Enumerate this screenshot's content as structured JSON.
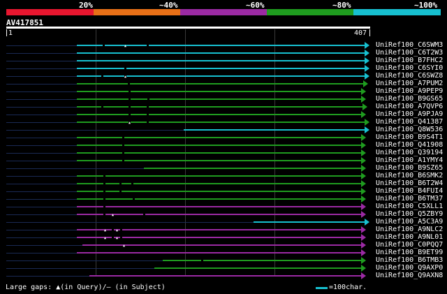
{
  "header": {
    "identity_ticks": [
      "20%",
      "~40%",
      "~60%",
      "~80%",
      "~100%"
    ],
    "identity_colors": [
      "#e8162f",
      "#e87017",
      "#9b2aa3",
      "#1f9c1f",
      "#17c0d0"
    ],
    "query_id": "AV417851",
    "query_start": "1",
    "query_end": "407"
  },
  "hits": [
    {
      "name": "UniRef100_C6SWM3",
      "color": "cyan"
    },
    {
      "name": "UniRef100_C6T2W3",
      "color": "cyan"
    },
    {
      "name": "UniRef100_B7FHC2",
      "color": "cyan"
    },
    {
      "name": "UniRef100_C6SYI0",
      "color": "cyan"
    },
    {
      "name": "UniRef100_C6SWZ8",
      "color": "cyan"
    },
    {
      "name": "UniRef100_A7PUM2",
      "color": "green"
    },
    {
      "name": "UniRef100_A9PEP9",
      "color": "green"
    },
    {
      "name": "UniRef100_B9GS65",
      "color": "green"
    },
    {
      "name": "UniRef100_A7QVP6",
      "color": "green"
    },
    {
      "name": "UniRef100_A9PJA9",
      "color": "green"
    },
    {
      "name": "UniRef100_Q41387",
      "color": "green"
    },
    {
      "name": "UniRef100_Q8W536",
      "color": "cyan"
    },
    {
      "name": "UniRef100_B9S4T1",
      "color": "green"
    },
    {
      "name": "UniRef100_Q41908",
      "color": "green"
    },
    {
      "name": "UniRef100_Q39194",
      "color": "green"
    },
    {
      "name": "UniRef100_A1YMY4",
      "color": "green"
    },
    {
      "name": "UniRef100_B9SZ65",
      "color": "green"
    },
    {
      "name": "UniRef100_B6SMK2",
      "color": "green"
    },
    {
      "name": "UniRef100_B6T2W4",
      "color": "green"
    },
    {
      "name": "UniRef100_B4FUI4",
      "color": "green"
    },
    {
      "name": "UniRef100_B6TM37",
      "color": "green"
    },
    {
      "name": "UniRef100_C5XLL1",
      "color": "purple"
    },
    {
      "name": "UniRef100_Q5ZBY9",
      "color": "purple"
    },
    {
      "name": "UniRef100_A5C3A9",
      "color": "cyan"
    },
    {
      "name": "UniRef100_A9NLC2",
      "color": "purple"
    },
    {
      "name": "UniRef100_A9NL01",
      "color": "purple"
    },
    {
      "name": "UniRef100_C0PQQ7",
      "color": "purple"
    },
    {
      "name": "UniRef100_B9ET99",
      "color": "purple"
    },
    {
      "name": "UniRef100_B6TMB3",
      "color": "green"
    },
    {
      "name": "UniRef100_Q9AXP0",
      "color": "green"
    },
    {
      "name": "UniRef100_Q9AXN8",
      "color": "purple"
    }
  ],
  "legend": {
    "gaps_text": "Large gaps: ▲(in Query)/– (in Subject)",
    "scale_text": "=100char."
  }
}
